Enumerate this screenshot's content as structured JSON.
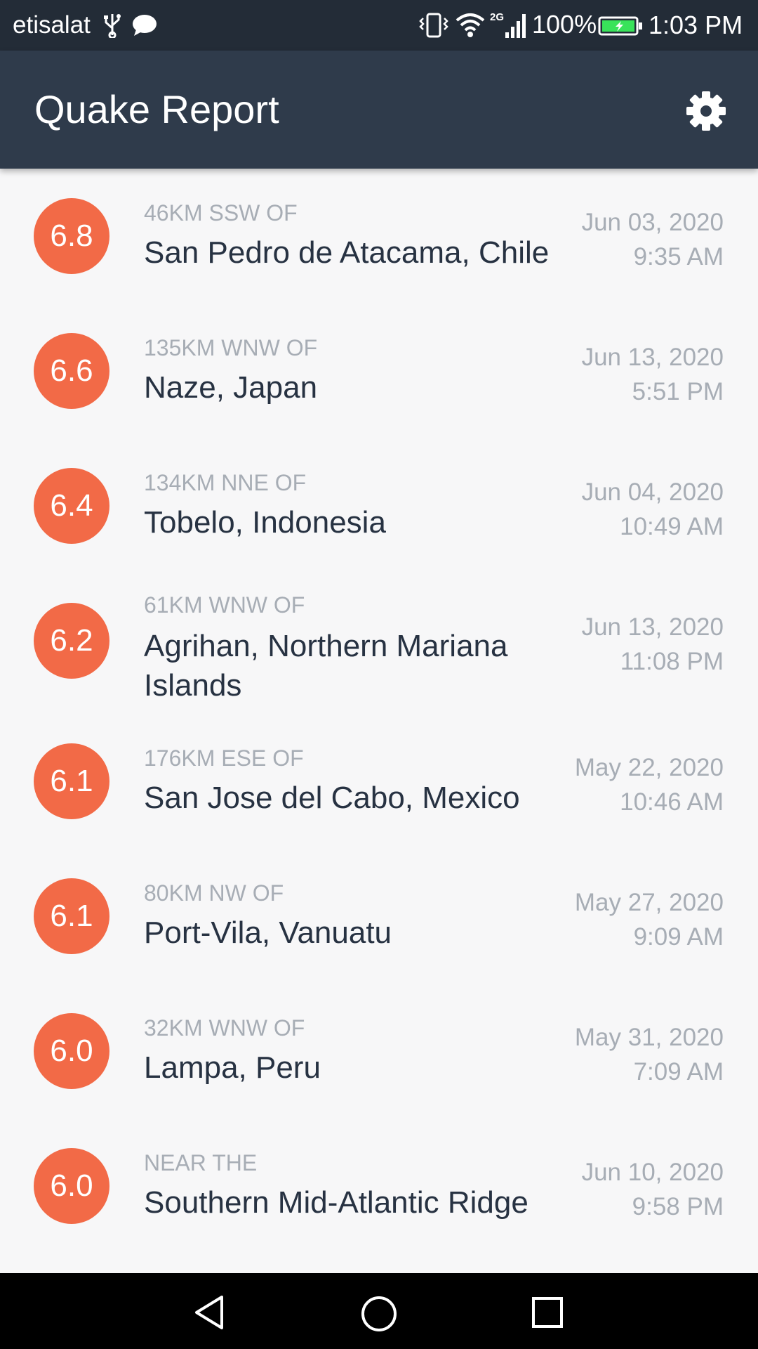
{
  "status": {
    "carrier": "etisalat",
    "network": "2G",
    "battery_percent": "100%",
    "time": "1:03 PM"
  },
  "app": {
    "title": "Quake Report",
    "settings_icon": "gear-icon"
  },
  "quakes": [
    {
      "mag": "6.8",
      "offset": "46km SSW of",
      "place": "San Pedro de Atacama, Chile",
      "date": "Jun 03, 2020",
      "time": "9:35 AM"
    },
    {
      "mag": "6.6",
      "offset": "135km WNW of",
      "place": "Naze, Japan",
      "date": "Jun 13, 2020",
      "time": "5:51 PM"
    },
    {
      "mag": "6.4",
      "offset": "134km NNE of",
      "place": "Tobelo, Indonesia",
      "date": "Jun 04, 2020",
      "time": "10:49 AM"
    },
    {
      "mag": "6.2",
      "offset": "61km WNW of",
      "place": "Agrihan, Northern Mariana Islands",
      "date": "Jun 13, 2020",
      "time": "11:08 PM"
    },
    {
      "mag": "6.1",
      "offset": "176km ESE of",
      "place": "San Jose del Cabo, Mexico",
      "date": "May 22, 2020",
      "time": "10:46 AM"
    },
    {
      "mag": "6.1",
      "offset": "80km NW of",
      "place": "Port-Vila, Vanuatu",
      "date": "May 27, 2020",
      "time": "9:09 AM"
    },
    {
      "mag": "6.0",
      "offset": "32km WNW of",
      "place": "Lampa, Peru",
      "date": "May 31, 2020",
      "time": "7:09 AM"
    },
    {
      "mag": "6.0",
      "offset": "Near the",
      "place": "Southern Mid-Atlantic Ridge",
      "date": "Jun 10, 2020",
      "time": "9:58 PM"
    }
  ],
  "colors": {
    "status_bar": "#232c37",
    "app_bar": "#2f3b4b",
    "magnitude": "#f26a47",
    "primary_text": "#273242",
    "secondary_text": "#a7adb5",
    "battery": "#39e35a"
  },
  "nav": {
    "back_icon": "back-triangle-icon",
    "home_icon": "home-circle-icon",
    "recents_icon": "recents-square-icon"
  }
}
